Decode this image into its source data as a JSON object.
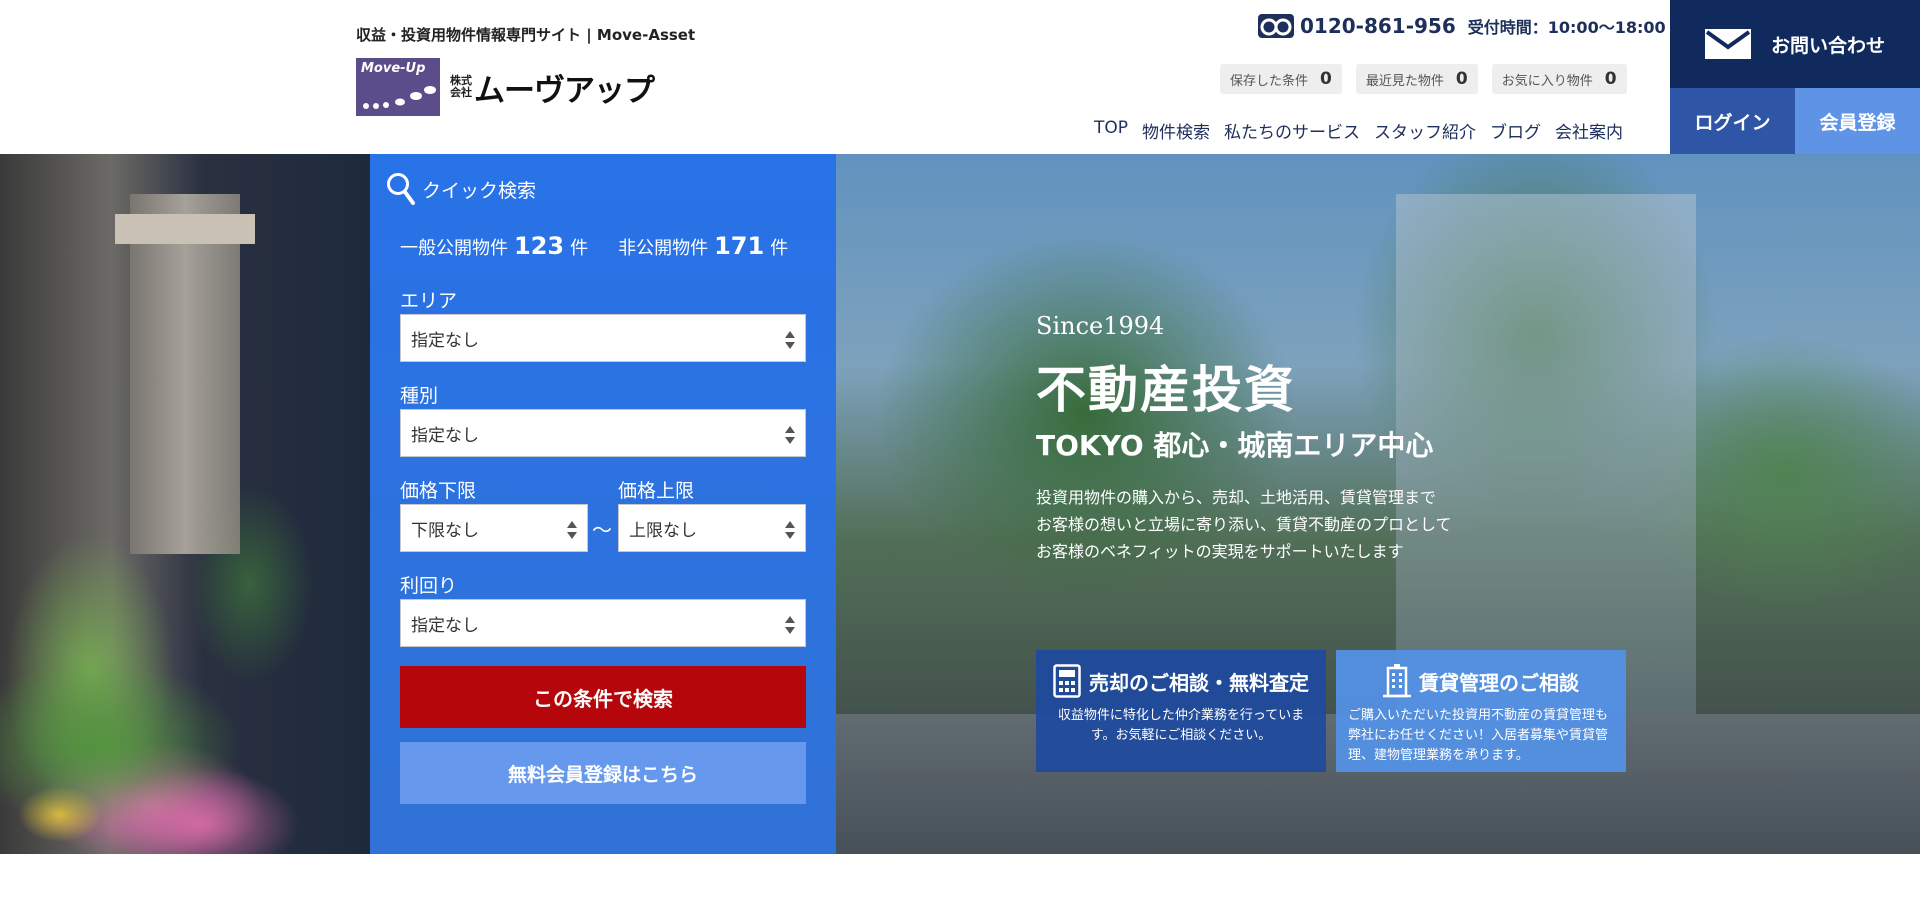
{
  "header": {
    "tagline": "収益・投資用物件情報専門サイト | Move-Asset",
    "logo": {
      "mark_text": "Move-Up",
      "kabu_line1": "株式",
      "kabu_line2": "会社",
      "company": "ムーヴアップ",
      "color": "#5b4d8a"
    },
    "phone": {
      "icon": "freedial-icon",
      "number": "0120-861-956",
      "hours": "受付時間：10:00〜18:00"
    },
    "counters": [
      {
        "label": "保存した条件",
        "count": "0"
      },
      {
        "label": "最近見た物件",
        "count": "0"
      },
      {
        "label": "お気に入り物件",
        "count": "0"
      }
    ],
    "nav": [
      "TOP",
      "物件検索",
      "私たちのサービス",
      "スタッフ紹介",
      "ブログ",
      "会社案内"
    ],
    "contact_label": "お問い合わせ",
    "login_label": "ログイン",
    "register_label": "会員登録",
    "colors": {
      "navy": "#112a5e",
      "login": "#2f56a6",
      "register": "#5e93e6"
    }
  },
  "search": {
    "title": "クイック検索",
    "public_label": "一般公開物件",
    "public_count": "123",
    "private_label": "非公開物件",
    "private_count": "171",
    "unit": "件",
    "area_label": "エリア",
    "area_value": "指定なし",
    "type_label": "種別",
    "type_value": "指定なし",
    "price_min_label": "価格下限",
    "price_min_value": "下限なし",
    "price_max_label": "価格上限",
    "price_max_value": "上限なし",
    "tilde": "〜",
    "yield_label": "利回り",
    "yield_value": "指定なし",
    "search_button": "この条件で検索",
    "free_register_button": "無料会員登録はこちら",
    "colors": {
      "search_button": "#b5060c",
      "free_button": "#6699ee"
    }
  },
  "hero": {
    "since": "Since1994",
    "headline": "不動産投資",
    "sub": "TOKYO 都心・城南エリア中心",
    "desc_lines": [
      "投資用物件の購入から、売却、土地活用、賃貸管理まで",
      "お客様の想いと立場に寄り添い、賃貸不動産のプロとして",
      "お客様のベネフィットの実現をサポートいたします"
    ],
    "cta1": {
      "icon": "calculator-icon",
      "title": "売却のご相談・無料査定",
      "body": "収益物件に特化した仲介業務を行っています。お気軽にご相談ください。"
    },
    "cta2": {
      "icon": "building-icon",
      "title": "賃貸管理のご相談",
      "body": "ご購入いただいた投資用不動産の賃貸管理も弊社にお任せください！入居者募集や賃貸管理、建物管理業務を承ります。"
    }
  }
}
